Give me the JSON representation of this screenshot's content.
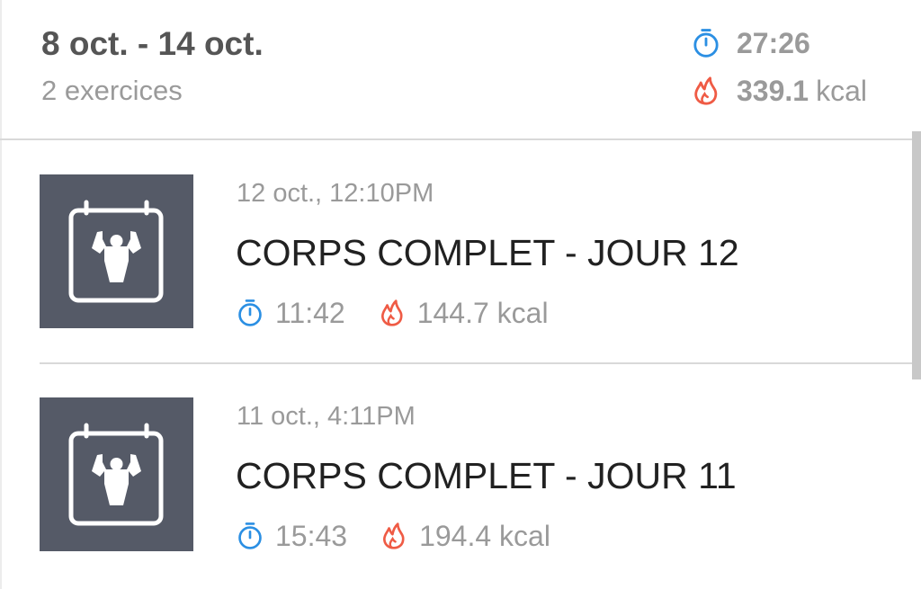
{
  "summary": {
    "date_range": "8 oct. - 14 oct.",
    "exercise_count": "2 exercices",
    "total_duration": "27:26",
    "total_calories": "339.1",
    "calories_unit": "kcal"
  },
  "workouts": [
    {
      "datetime": "12 oct., 12:10PM",
      "title": "CORPS COMPLET - JOUR 12",
      "duration": "11:42",
      "calories": "144.7 kcal"
    },
    {
      "datetime": "11 oct., 4:11PM",
      "title": "CORPS COMPLET - JOUR 11",
      "duration": "15:43",
      "calories": "194.4 kcal"
    }
  ],
  "icons": {
    "duration": "stopwatch-icon",
    "calories": "flame-icon",
    "workout_thumb": "calendar-bodybuilder-icon"
  },
  "colors": {
    "stopwatch": "#2b8fe3",
    "flame": "#ef5b45",
    "thumb_bg": "#555a67"
  }
}
